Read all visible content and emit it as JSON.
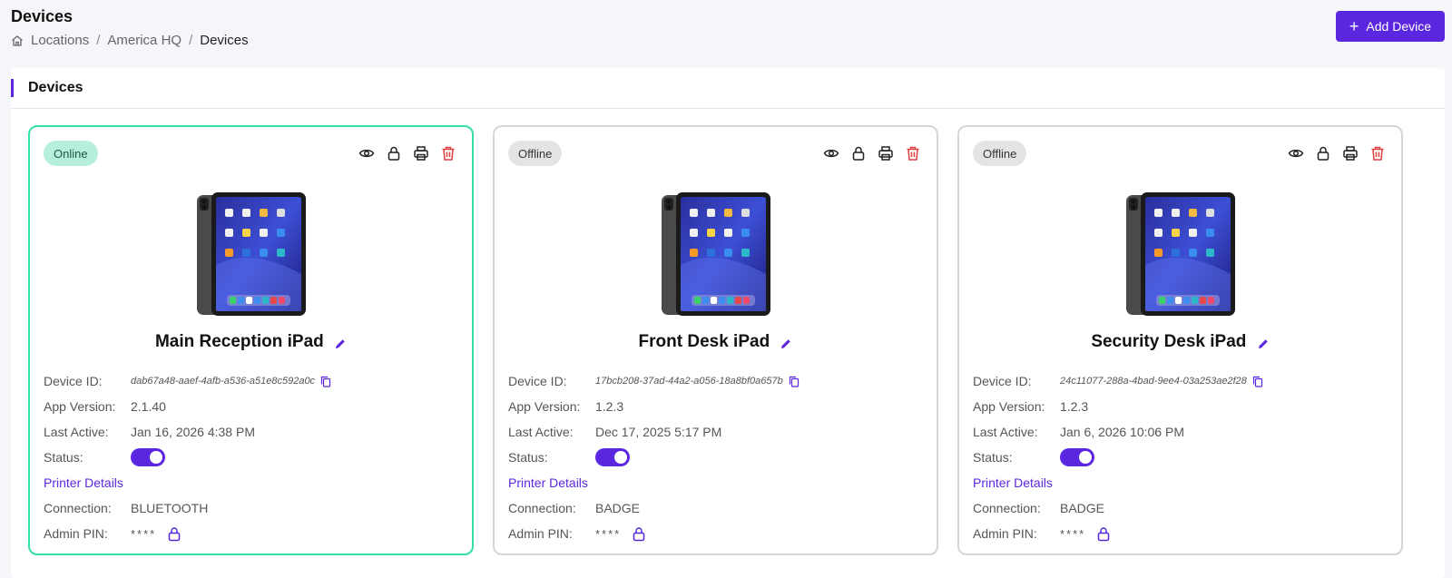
{
  "page": {
    "title": "Devices",
    "breadcrumb": [
      "Locations",
      "America HQ",
      "Devices"
    ],
    "add_button": "Add Device"
  },
  "panel": {
    "title": "Devices"
  },
  "labels": {
    "device_id": "Device ID:",
    "app_version": "App Version:",
    "last_active": "Last Active:",
    "status": "Status:",
    "printer_details": "Printer Details",
    "connection": "Connection:",
    "admin_pin": "Admin PIN:"
  },
  "colors": {
    "accent": "#5b26e0",
    "online_border": "#34e0a8",
    "delete": "#e04040"
  },
  "icons": [
    "home-icon",
    "plus-icon",
    "eye-icon",
    "lock-icon",
    "printer-icon",
    "trash-icon",
    "edit-icon",
    "copy-icon"
  ],
  "devices": [
    {
      "status_badge": "Online",
      "name": "Main Reception iPad",
      "device_id": "dab67a48-aaef-4afb-a536-a51e8c592a0c",
      "app_version": "2.1.40",
      "last_active": "Jan 16, 2026 4:38 PM",
      "status_enabled": true,
      "connection": "BLUETOOTH",
      "admin_pin": "****"
    },
    {
      "status_badge": "Offline",
      "name": "Front Desk iPad",
      "device_id": "17bcb208-37ad-44a2-a056-18a8bf0a657b",
      "app_version": "1.2.3",
      "last_active": "Dec 17, 2025 5:17 PM",
      "status_enabled": true,
      "connection": "BADGE",
      "admin_pin": "****"
    },
    {
      "status_badge": "Offline",
      "name": "Security Desk iPad",
      "device_id": "24c11077-288a-4bad-9ee4-03a253ae2f28",
      "app_version": "1.2.3",
      "last_active": "Jan 6, 2026 10:06 PM",
      "status_enabled": true,
      "connection": "BADGE",
      "admin_pin": "****"
    }
  ]
}
